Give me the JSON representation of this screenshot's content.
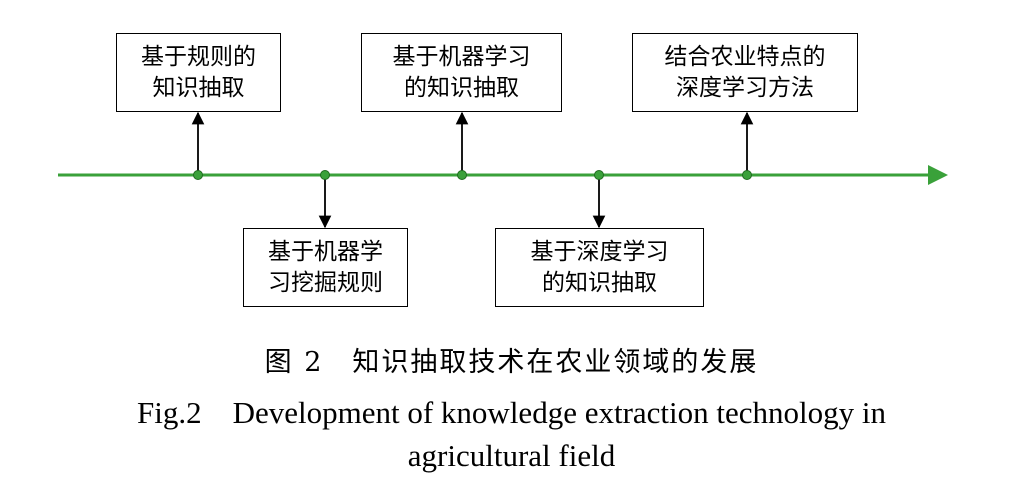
{
  "timeline": {
    "events": [
      {
        "id": "rule-based",
        "position": "above",
        "lines": [
          "基于规则的",
          "知识抽取"
        ]
      },
      {
        "id": "ml-rule-mining",
        "position": "below",
        "lines": [
          "基于机器学",
          "习挖掘规则"
        ]
      },
      {
        "id": "ml-extraction",
        "position": "above",
        "lines": [
          "基于机器学习",
          "的知识抽取"
        ]
      },
      {
        "id": "dl-extraction",
        "position": "below",
        "lines": [
          "基于深度学习",
          "的知识抽取"
        ]
      },
      {
        "id": "agri-dl",
        "position": "above",
        "lines": [
          "结合农业特点的",
          "深度学习方法"
        ]
      }
    ]
  },
  "caption": {
    "cn": "图 2　知识抽取技术在农业领域的发展",
    "en_line1": "Fig.2　Development of knowledge extraction technology in",
    "en_line2": "agricultural field"
  },
  "colors": {
    "axis": "#3aa13a",
    "node": "#3aa13a",
    "connector": "#000000",
    "box_border": "#000000"
  }
}
